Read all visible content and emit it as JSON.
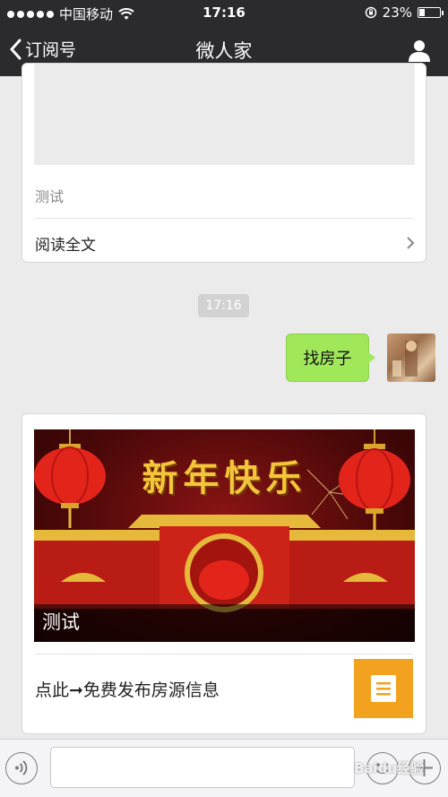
{
  "status_bar": {
    "carrier": "中国移动",
    "time": "17:16",
    "battery": "23%",
    "battery_level": 0.23
  },
  "nav": {
    "back_label": "订阅号",
    "title": "微人家"
  },
  "card_top": {
    "description": "测试",
    "read_all": "阅读全文"
  },
  "timestamp": "17:16",
  "outgoing_message": "找房子",
  "card_news": {
    "cover_banner": "新年快乐",
    "cover_title": "测试",
    "item_text": "点此➞免费发布房源信息"
  },
  "input": {
    "placeholder": ""
  },
  "watermark": "Baidu经验",
  "colors": {
    "bar": "#2b2b2d",
    "chat_bg": "#ebebeb",
    "bubble": "#a0e75a",
    "thumb_orange": "#f3a21f"
  }
}
